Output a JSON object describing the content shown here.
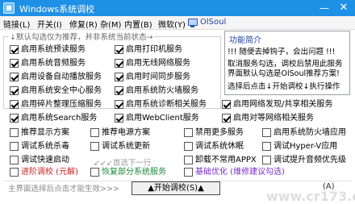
{
  "window": {
    "title": "Windows系统调校",
    "minimize": "—",
    "close": "✕"
  },
  "menu": [
    "链接(L)",
    "开关(I)",
    "修复(R)",
    "杂(M)",
    "内置(B)",
    "微软(Y)",
    "OlSoul"
  ],
  "group_legend": "↓默认勾选仅为推荐，并非系统当前状态→",
  "info": {
    "title": "功能简介",
    "lines": [
      "!!! 随便去掉钩子，会出问题 !!!",
      "取消服务勾选，调校后禁用此服务",
      "界面默认勾选是OlSoul推荐方案!",
      "选择后点击↓开始调校↓执行操作"
    ]
  },
  "checkboxes": [
    {
      "label": "启用系统预读服务",
      "checked": true
    },
    {
      "label": "启用打印机服务",
      "checked": true
    },
    {
      "label": "启用系统音频服务",
      "checked": true
    },
    {
      "label": "启用无线网络服务",
      "checked": true
    },
    {
      "label": "启用设备自动播放服务",
      "checked": true
    },
    {
      "label": "启用时间同步服务",
      "checked": true
    },
    {
      "label": "启用系统安全中心服务",
      "checked": true
    },
    {
      "label": "启用系统防火墙服务",
      "checked": true
    },
    {
      "label": "启用碎片整理压缩服务",
      "checked": true
    },
    {
      "label": "启用系统诊断相关服务",
      "checked": true
    },
    {
      "label": "启用网络发现/共享相关服务",
      "checked": true
    },
    {
      "label": "启用系统Search服务",
      "checked": true
    },
    {
      "label": "启用WebClient服务",
      "checked": true
    },
    {
      "label": "启用对等网络相关服务",
      "checked": true
    },
    {
      "label": "推荐显示方案",
      "checked": false
    },
    {
      "label": "推荐电源方案",
      "checked": false
    },
    {
      "label": "禁用更多服务",
      "checked": false
    },
    {
      "label": "启用系统防火墙应用",
      "checked": false
    },
    {
      "label": "调试系统杀毒",
      "checked": false
    },
    {
      "label": "调试系统更新",
      "checked": false
    },
    {
      "label": "调试系统休眠",
      "checked": false
    },
    {
      "label": "调试Hyper-V应用",
      "checked": false
    },
    {
      "label": "调试快速启动",
      "checked": false
    },
    {
      "label": "卸载不常用APPX",
      "checked": false
    },
    {
      "label": "调试提升音频优先级",
      "checked": false
    },
    {
      "label": "进阶调校 (元解)",
      "checked": false
    },
    {
      "label": "恢复部分系统服务",
      "checked": false
    },
    {
      "label": "基础优化 (维修建议勾选)",
      "checked": false
    }
  ],
  "arrow_text": "↙↙↙首选下一行",
  "status_text": "主界面选择后点击才能生效>>>",
  "start_button": "▲开始调校(S)▲",
  "version": "(A)",
  "watermark": "www.cr173.com"
}
